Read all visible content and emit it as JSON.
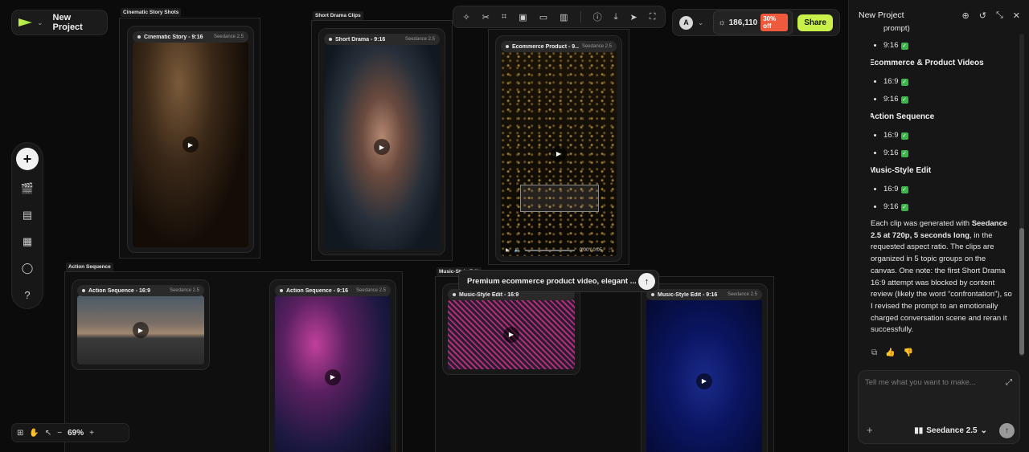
{
  "project": {
    "name": "New Project"
  },
  "zoom": {
    "value": "69%"
  },
  "credits": {
    "amount": "186,110",
    "discount": "30% off"
  },
  "user": {
    "initial": "A"
  },
  "share_label": "Share",
  "prompt_tooltip": "Premium ecommerce product video, elegant ...",
  "groups": [
    {
      "label": "Cinematic Story Shots"
    },
    {
      "label": "Short Drama Clips"
    },
    {
      "label": "Action Sequence"
    },
    {
      "label": "Music-Style Edit"
    }
  ],
  "cards": [
    {
      "title": "Cinematic Story - 9:16",
      "model": "Seedance 2.5"
    },
    {
      "title": "Short Drama - 9:16",
      "model": "Seedance 2.5"
    },
    {
      "title": "Ecommerce Product - 9...",
      "model": "Seedance 2.5",
      "time": "0:00 / 0:05"
    },
    {
      "title": "Action Sequence - 16:9",
      "model": "Seedance 2.5"
    },
    {
      "title": "Action Sequence - 9:16",
      "model": "Seedance 2.5"
    },
    {
      "title": "Music-Style Edit - 16:9",
      "model": ""
    },
    {
      "title": "Music-Style Edit - 9:16",
      "model": "Seedance 2.5"
    }
  ],
  "panel": {
    "title": "New Project",
    "chat": {
      "truncated": "prompt)",
      "sections": [
        {
          "heading": "",
          "items": [
            "9:16"
          ]
        },
        {
          "heading": "Ecommerce & Product Videos",
          "items": [
            "16:9",
            "9:16"
          ]
        },
        {
          "heading": "Action Sequence",
          "items": [
            "16:9",
            "9:16"
          ]
        },
        {
          "heading": "Music-Style Edit",
          "items": [
            "16:9",
            "9:16"
          ]
        }
      ],
      "summary_parts": {
        "a": "Each clip was generated with ",
        "b": "Seedance 2.5 at 720p, 5 seconds long",
        "c": ", in the requested aspect ratio. The clips are organized in 5 topic groups on the canvas. One note: the first Short Drama 16:9 attempt was blocked by content review (likely the word “confrontation”), so I revised the prompt to an emotionally charged conversation scene and reran it successfully."
      }
    },
    "composer": {
      "placeholder": "Tell me what you want to make...",
      "model": "Seedance 2.5"
    }
  }
}
